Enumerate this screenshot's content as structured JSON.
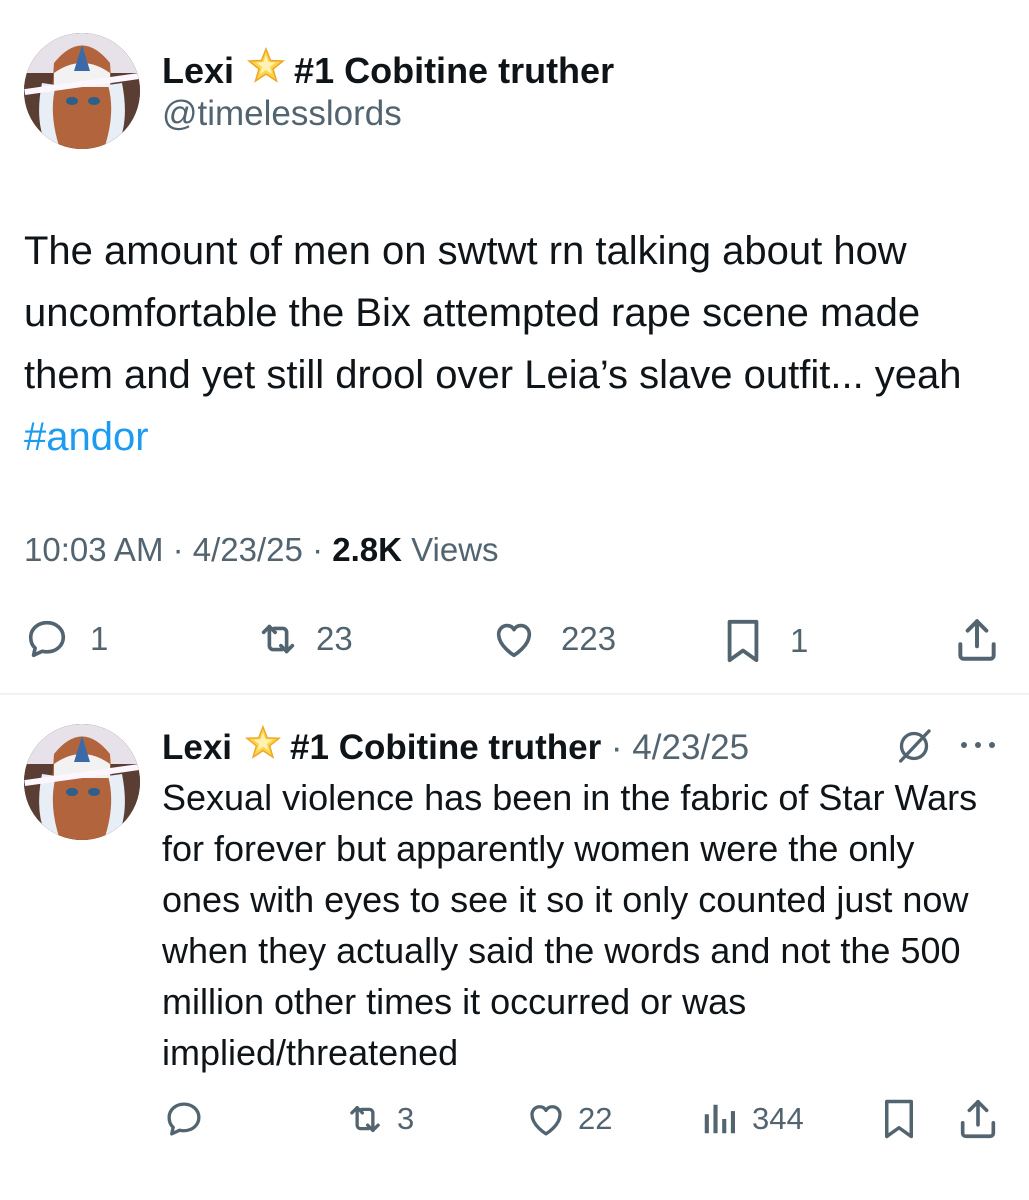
{
  "main_tweet": {
    "name": "Lexi",
    "badge_text": "#1 Cobitine truther",
    "handle": "@timelesslords",
    "text_before": "The amount of men on swtwt rn talking about how uncomfortable the Bix attempted rape scene made them and yet still drool over Leia’s slave outfit... yeah ",
    "hashtag": "#andor",
    "time": "10:03 AM",
    "date": "4/23/25",
    "views_count": "2.8K",
    "views_label": "Views",
    "replies": "1",
    "reposts": "23",
    "likes": "223",
    "bookmarks": "1"
  },
  "reply_tweet": {
    "name": "Lexi",
    "badge_text": "#1 Cobitine truther",
    "date": "4/23/25",
    "text": "Sexual violence has been in the fabric of Star Wars for forever but apparently women were the only ones with eyes to see it so it only counted just now when they actually said the words and not the 500 million other times it occurred or was implied/threatened",
    "reposts": "3",
    "likes": "22",
    "views": "344"
  },
  "icons": {
    "star": "glowing-star-emoji",
    "reply": "speech-bubble-icon",
    "repost": "repost-arrows-icon",
    "like": "heart-icon",
    "bookmark": "bookmark-icon",
    "share": "share-icon",
    "views": "bar-chart-icon",
    "grok": "grok-icon",
    "more": "more-dots-icon"
  },
  "colors": {
    "text": "#0f1419",
    "secondary": "#536471",
    "hashtag": "#1d9bf0",
    "divider": "#eff3f4"
  }
}
